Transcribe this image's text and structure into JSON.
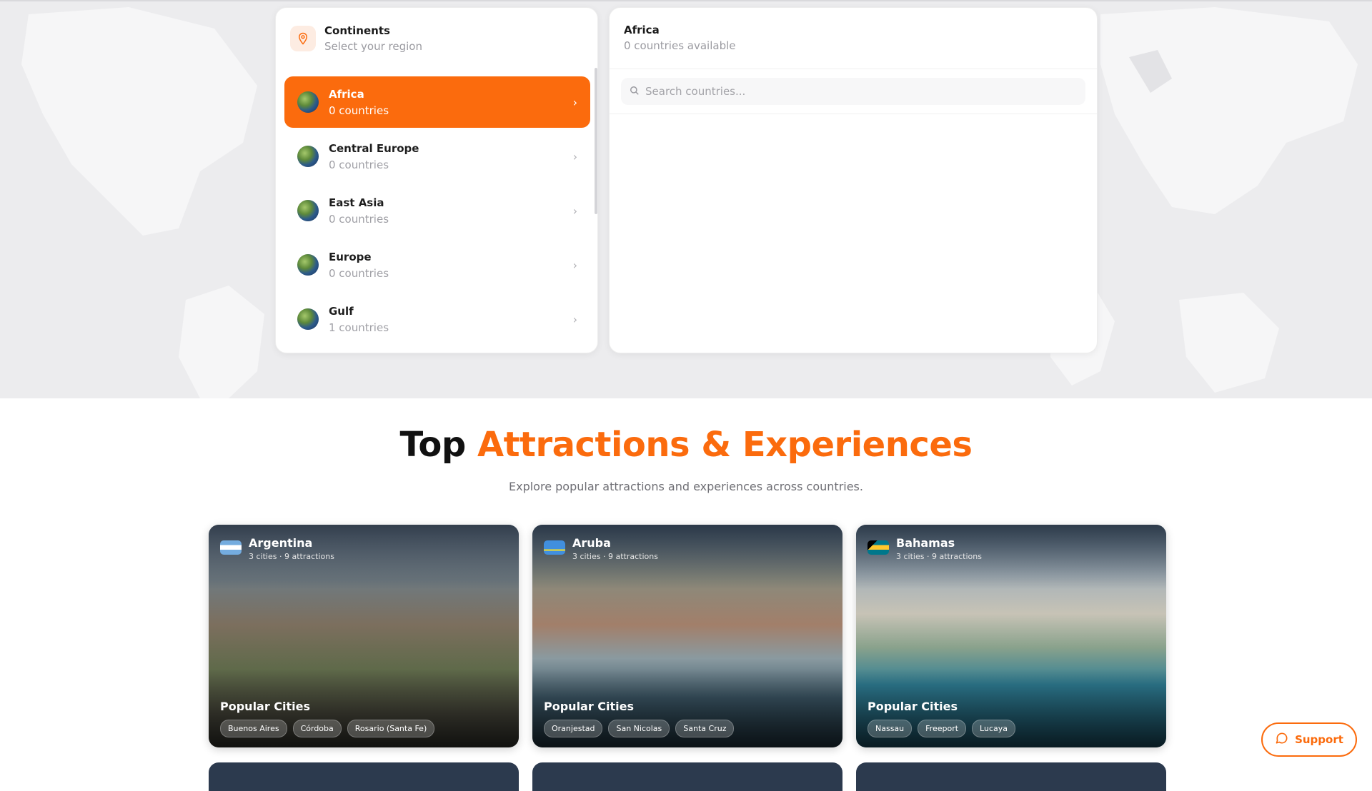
{
  "colors": {
    "accent": "#fb6b0d",
    "map_bg": "#ececee",
    "land": "#f6f6f7"
  },
  "continents_panel": {
    "title": "Continents",
    "subtitle": "Select your region",
    "icon": "map-pin-icon",
    "items": [
      {
        "name": "Africa",
        "count": "0 countries",
        "active": true
      },
      {
        "name": "Central Europe",
        "count": "0 countries",
        "active": false
      },
      {
        "name": "East Asia",
        "count": "0 countries",
        "active": false
      },
      {
        "name": "Europe",
        "count": "0 countries",
        "active": false
      },
      {
        "name": "Gulf",
        "count": "1 countries",
        "active": false
      }
    ]
  },
  "countries_panel": {
    "title": "Africa",
    "subtitle": "0 countries available",
    "search_placeholder": "Search countries..."
  },
  "section": {
    "title_part1": "Top",
    "title_part2": "Attractions & Experiences",
    "subtitle": "Explore popular attractions and experiences across countries."
  },
  "cards": [
    {
      "country": "Argentina",
      "meta": "3 cities · 9 attractions",
      "popular_label": "Popular Cities",
      "cities": [
        "Buenos Aires",
        "Córdoba",
        "Rosario (Santa Fe)"
      ]
    },
    {
      "country": "Aruba",
      "meta": "3 cities · 9 attractions",
      "popular_label": "Popular Cities",
      "cities": [
        "Oranjestad",
        "San Nicolas",
        "Santa Cruz"
      ]
    },
    {
      "country": "Bahamas",
      "meta": "3 cities · 9 attractions",
      "popular_label": "Popular Cities",
      "cities": [
        "Nassau",
        "Freeport",
        "Lucaya"
      ]
    }
  ],
  "support": {
    "label": "Support",
    "icon": "chat-bubble-icon"
  }
}
